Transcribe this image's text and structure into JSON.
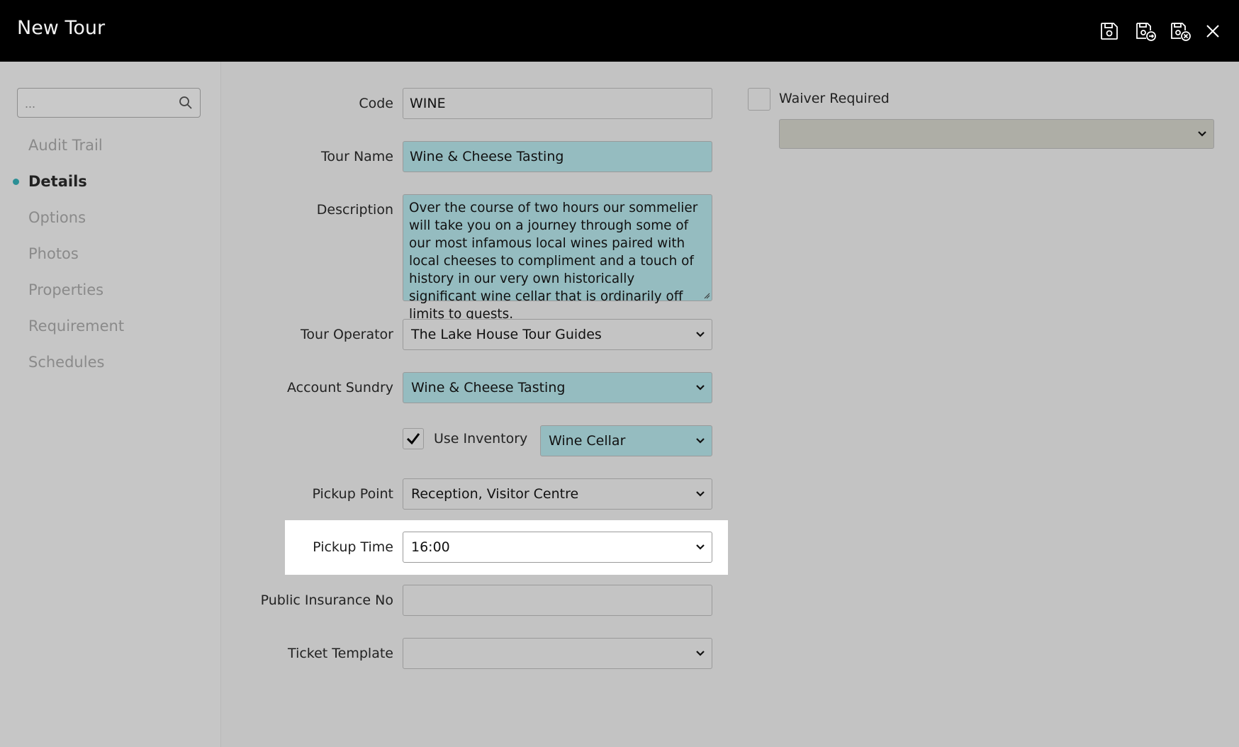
{
  "window": {
    "title": "New Tour"
  },
  "toolbar": {
    "icons": [
      "save-icon",
      "save-and-new-icon",
      "save-and-close-icon",
      "close-icon"
    ]
  },
  "sidebar": {
    "search_placeholder": "...",
    "items": [
      {
        "label": "Audit Trail"
      },
      {
        "label": "Details",
        "active": true
      },
      {
        "label": "Options"
      },
      {
        "label": "Photos"
      },
      {
        "label": "Properties"
      },
      {
        "label": "Requirement"
      },
      {
        "label": "Schedules"
      }
    ]
  },
  "form": {
    "code": {
      "label": "Code",
      "value": "WINE"
    },
    "tour_name": {
      "label": "Tour Name",
      "value": "Wine & Cheese Tasting"
    },
    "description": {
      "label": "Description",
      "value": "Over the course of two hours our sommelier will take you on a journey through some of our most infamous local wines paired with local cheeses to compliment and a touch of history in our very own historically significant wine cellar that is ordinarily off limits to guests."
    },
    "tour_operator": {
      "label": "Tour Operator",
      "value": "The Lake House Tour Guides"
    },
    "account_sundry": {
      "label": "Account Sundry",
      "value": "Wine & Cheese Tasting"
    },
    "use_inventory": {
      "label": "Use Inventory",
      "checked": true,
      "location": "Wine Cellar"
    },
    "pickup_point": {
      "label": "Pickup Point",
      "value": "Reception, Visitor Centre"
    },
    "pickup_time": {
      "label": "Pickup Time",
      "value": "16:00"
    },
    "public_insurance_no": {
      "label": "Public Insurance No",
      "value": ""
    },
    "ticket_template": {
      "label": "Ticket Template",
      "value": ""
    },
    "waiver_required": {
      "label": "Waiver Required",
      "checked": false,
      "value": ""
    }
  },
  "colors": {
    "accent": "#2b8f95",
    "teal_field": "#95bcc0",
    "titlebar": "#000000",
    "background": "#c3c3c3"
  }
}
